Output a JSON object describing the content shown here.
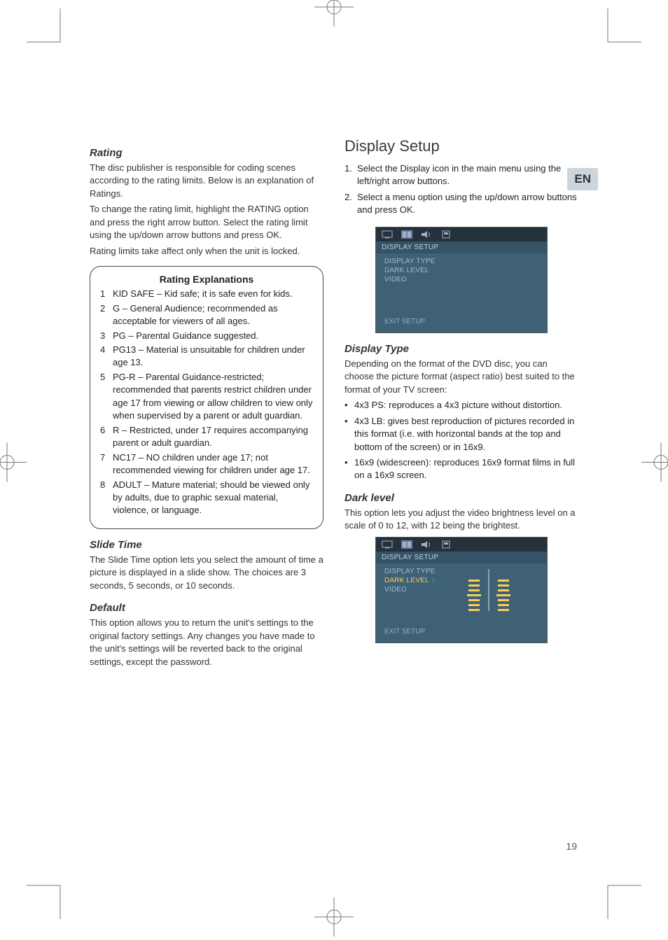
{
  "lang_tab": "EN",
  "page_number": "19",
  "left": {
    "rating": {
      "title": "Rating",
      "p1": "The disc publisher is responsible for coding scenes according to the rating limits. Below is an explanation of Ratings.",
      "p2": "To change the rating limit, highlight the RATING option and press the right arrow button. Select the rating limit using the up/down arrow buttons and press OK.",
      "p3": "Rating limits take affect only when the unit is locked.",
      "box_title": "Rating Explanations",
      "items": [
        {
          "n": "1",
          "t": "KID SAFE – Kid safe; it is safe even for kids."
        },
        {
          "n": "2",
          "t": "G – General Audience; recommended as acceptable for viewers of all ages."
        },
        {
          "n": "3",
          "t": "PG – Parental Guidance suggested."
        },
        {
          "n": "4",
          "t": "PG13 – Material is unsuitable for children under age 13."
        },
        {
          "n": "5",
          "t": "PG-R – Parental Guidance-restricted; recommended that parents restrict children under age 17 from viewing or allow children to view only when supervised by a parent or adult guardian."
        },
        {
          "n": "6",
          "t": "R – Restricted, under 17 requires accompanying parent or adult guardian."
        },
        {
          "n": "7",
          "t": "NC17 – NO children under age 17; not recommended viewing for children under age 17."
        },
        {
          "n": "8",
          "t": "ADULT – Mature material; should be viewed only by adults, due to graphic sexual material, violence, or language."
        }
      ]
    },
    "slide": {
      "title": "Slide Time",
      "body": "The Slide Time option lets you select the amount of time a picture is displayed in a slide show. The choices are 3 seconds, 5 seconds, or 10 seconds."
    },
    "default": {
      "title": "Default",
      "body": "This option allows you to return the unit's settings to the original factory settings. Any changes you have made to the unit's settings will be reverted back to the original settings, except the password."
    }
  },
  "right": {
    "display_setup": {
      "title": "Display Setup",
      "steps": [
        {
          "n": "1.",
          "t": "Select the Display icon in the main menu using the left/right arrow buttons."
        },
        {
          "n": "2.",
          "t": "Select a menu option using the up/down arrow buttons and press OK."
        }
      ]
    },
    "osd1": {
      "header": "DISPLAY SETUP",
      "items": [
        "DISPLAY TYPE",
        "DARK LEVEL",
        "VIDEO"
      ],
      "footer": "EXIT SETUP"
    },
    "display_type": {
      "title": "Display Type",
      "intro": "Depending on the format of the DVD disc, you can choose the picture format (aspect ratio) best suited to the format of your TV screen:",
      "bullets": [
        "4x3 PS: reproduces a 4x3 picture without distortion.",
        "4x3 LB: gives best reproduction of pictures recorded in this format (i.e. with horizontal bands at the top and bottom of the screen) or in 16x9.",
        "16x9 (widescreen): reproduces 16x9 format films in full on a 16x9 screen."
      ]
    },
    "dark_level": {
      "title": "Dark level",
      "body": "This option lets you adjust the video brightness level on a scale of 0 to 12, with 12 being the brightest."
    },
    "osd2": {
      "header": "DISPLAY SETUP",
      "items": [
        "DISPLAY TYPE",
        "DARK LEVEL",
        "VIDEO"
      ],
      "selected_index": 1,
      "footer": "EXIT SETUP"
    }
  }
}
